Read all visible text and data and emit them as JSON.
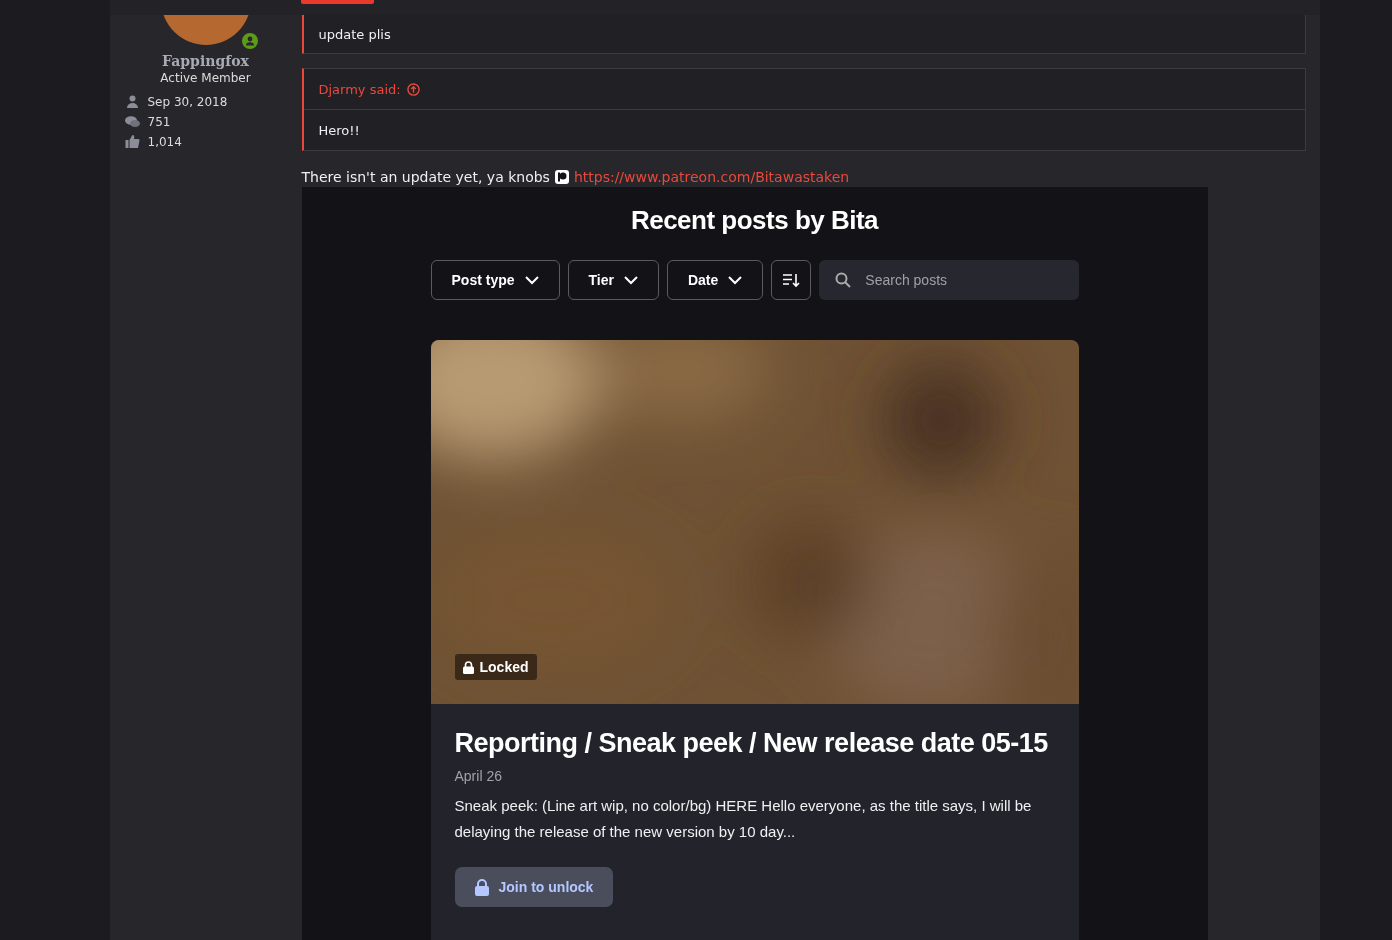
{
  "user": {
    "name": "Fappingfox",
    "title": "Active Member",
    "online": true,
    "stats": [
      {
        "kind": "joined",
        "value": "Sep 30, 2018"
      },
      {
        "kind": "messages",
        "value": "751"
      },
      {
        "kind": "reactions",
        "value": "1,014"
      }
    ]
  },
  "quotes": [
    {
      "text": "update plis"
    },
    {
      "author": "Djarmy said:",
      "text": "Hero!!"
    }
  ],
  "message": {
    "text": "There isn't an update yet, ya knobs",
    "link": "https://www.patreon.com/Bitawastaken"
  },
  "embed": {
    "heading": "Recent posts by Bita",
    "filters": [
      {
        "kind": "dropdown",
        "label": "Post type"
      },
      {
        "kind": "dropdown",
        "label": "Tier"
      },
      {
        "kind": "dropdown",
        "label": "Date"
      },
      {
        "kind": "sort"
      }
    ],
    "search": {
      "placeholder": "Search posts"
    },
    "post": {
      "badge": "Locked",
      "title": "Reporting / Sneak peek / New release date 05-15",
      "date": "April 26",
      "excerpt": "Sneak peek: (Line art wip, no color/bg) HERE Hello everyone, as the title says, I will be delaying the release of the new version by 10 day...",
      "button": "Join to unlock"
    }
  }
}
